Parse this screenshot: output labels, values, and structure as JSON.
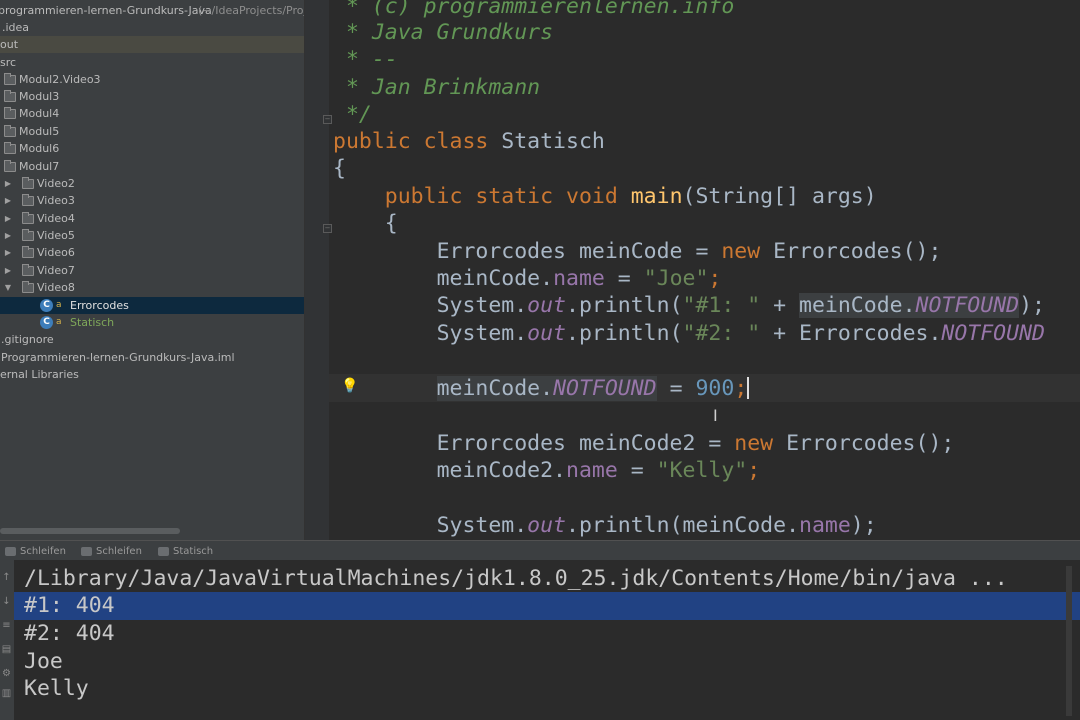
{
  "sidebar": {
    "items": [
      {
        "label": "programmieren-lernen-Grundkurs-Java",
        "suffix": "(~/IdeaProjects/Proj"
      },
      {
        "label": ".idea"
      },
      {
        "label": "out"
      },
      {
        "label": "src"
      },
      {
        "label": "Modul2.Video3"
      },
      {
        "label": "Modul3"
      },
      {
        "label": "Modul4"
      },
      {
        "label": "Modul5"
      },
      {
        "label": "Modul6"
      },
      {
        "label": "Modul7"
      },
      {
        "label": "Video2"
      },
      {
        "label": "Video3"
      },
      {
        "label": "Video4"
      },
      {
        "label": "Video5"
      },
      {
        "label": "Video6"
      },
      {
        "label": "Video7"
      },
      {
        "label": "Video8"
      },
      {
        "label": "Errorcodes"
      },
      {
        "label": "Statisch"
      },
      {
        "label": ".gitignore"
      },
      {
        "label": "Programmieren-lernen-Grundkurs-Java.iml"
      },
      {
        "label": "ernal Libraries"
      }
    ]
  },
  "editor": {
    "lines": [
      {
        "comment": " * (c) programmierenlernen.info"
      },
      {
        "comment": " * Java Grundkurs"
      },
      {
        "comment": " * --"
      },
      {
        "comment": " * Jan Brinkmann"
      },
      {
        "comment": " */"
      },
      {
        "kw": "public class ",
        "text": "Statisch"
      },
      {
        "text": "{"
      },
      {
        "indent": "    ",
        "kw": "public static void ",
        "fn": "main",
        "text": "(String[] args)"
      },
      {
        "indent": "    ",
        "text": "{"
      },
      {
        "indent": "        ",
        "a": "Errorcodes meinCode = ",
        "kw": "new ",
        "b": "Errorcodes();"
      },
      {
        "indent": "        ",
        "a": "meinCode.",
        "fld": "name",
        "b": " = ",
        "str": "\"Joe\"",
        "c": ";"
      },
      {
        "indent": "        ",
        "a": "System.",
        "st": "out",
        "b": ".println(",
        "str": "\"#1: \"",
        "c": " + ",
        "d": "meinCode.",
        "st2": "NOTFOUND",
        "e": ");"
      },
      {
        "indent": "        ",
        "a": "System.",
        "st": "out",
        "b": ".println(",
        "str": "\"#2: \"",
        "c": " + Errorcodes.",
        "st2": "NOTFOUND"
      },
      {
        "indent": "        ",
        "a": "meinCode.",
        "st": "NOTFOUND",
        "b": " = ",
        "num": "900",
        "c": ";"
      },
      {
        "indent": "        ",
        "a": "Errorcodes meinCode2 = ",
        "kw": "new ",
        "b": "Errorcodes();"
      },
      {
        "indent": "        ",
        "a": "meinCode2.",
        "fld": "name",
        "b": " = ",
        "str": "\"Kelly\"",
        "c": ";"
      },
      {
        "indent": "        ",
        "a": "System.",
        "st": "out",
        "b": ".println(meinCode.",
        "fld": "name",
        "c": ");"
      }
    ]
  },
  "run": {
    "tabs": [
      "Schleifen",
      "Schleifen",
      "Statisch"
    ],
    "console": [
      "/Library/Java/JavaVirtualMachines/jdk1.8.0_25.jdk/Contents/Home/bin/java ...",
      "#1: 404",
      "#2: 404",
      "Joe",
      "Kelly"
    ]
  },
  "colors": {
    "keyword": "#cc7832",
    "string": "#6a8759",
    "number": "#6897bb",
    "field": "#9876aa",
    "comment": "#629755",
    "selection": "#214283"
  },
  "icons": [
    "folder-icon",
    "class-icon",
    "lock-icon",
    "lightbulb-icon",
    "expand-arrow-icon"
  ]
}
